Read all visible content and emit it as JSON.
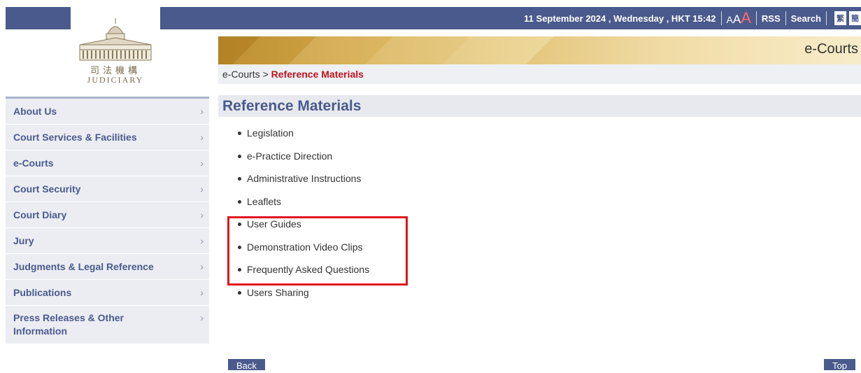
{
  "topbar": {
    "datetime": "11 September 2024 , Wednesday , HKT 15:42",
    "font_small": "A",
    "font_medium": "A",
    "font_large": "A",
    "rss": "RSS",
    "search": "Search",
    "lang_trad": "繁",
    "lang_simp": "簡"
  },
  "logo": {
    "chinese": "司法機構",
    "english": "JUDICIARY",
    "icon": "building-icon"
  },
  "banner": {
    "title": "e-Courts"
  },
  "breadcrumb": {
    "parent": "e-Courts",
    "separator": " > ",
    "current": "Reference Materials"
  },
  "sidebar": {
    "items": [
      {
        "label": "About Us"
      },
      {
        "label": "Court Services & Facilities"
      },
      {
        "label": "e-Courts"
      },
      {
        "label": "Court Security"
      },
      {
        "label": "Court Diary"
      },
      {
        "label": "Jury"
      },
      {
        "label": "Judgments & Legal Reference"
      },
      {
        "label": "Publications"
      },
      {
        "label": "Press Releases & Other Information"
      }
    ],
    "chevron": "›"
  },
  "main": {
    "title": "Reference Materials",
    "links": [
      "Legislation",
      "e-Practice Direction",
      "Administrative Instructions",
      "Leaflets",
      "User Guides",
      "Demonstration Video Clips",
      "Frequently Asked Questions",
      "Users Sharing"
    ]
  },
  "buttons": {
    "back": "Back",
    "top": "Top"
  },
  "colors": {
    "primary": "#4a5a8c",
    "highlight": "#e0141c",
    "breadcrumb_current": "#c0141c"
  }
}
